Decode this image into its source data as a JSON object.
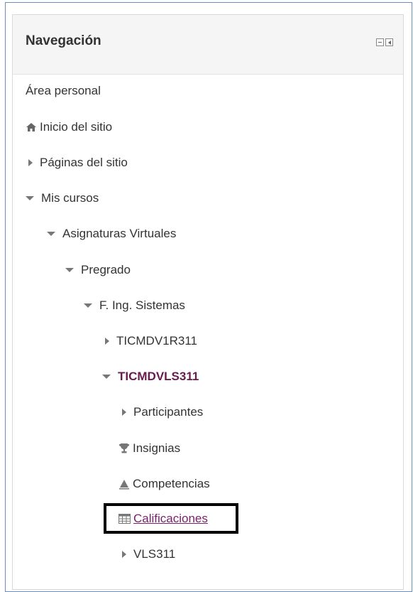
{
  "block": {
    "title": "Navegación",
    "controls": [
      "minimize-icon",
      "dock-icon"
    ]
  },
  "nav": [
    {
      "label": "Área personal",
      "icon": "none"
    },
    {
      "label": "Inicio del sitio",
      "icon": "home-icon"
    },
    {
      "label": "Páginas del sitio",
      "icon": "chevron-right-icon"
    },
    {
      "label": "Mis cursos",
      "icon": "chevron-down-icon"
    },
    {
      "label": "Asignaturas Virtuales",
      "icon": "chevron-down-icon"
    },
    {
      "label": "Pregrado",
      "icon": "chevron-down-icon"
    },
    {
      "label": "F. Ing. Sistemas",
      "icon": "chevron-down-icon"
    },
    {
      "label": "TICMDV1R311",
      "icon": "chevron-right-icon"
    },
    {
      "label": "TICMDVLS311",
      "icon": "chevron-down-icon",
      "state": "current"
    },
    {
      "label": "Participantes",
      "icon": "chevron-right-icon"
    },
    {
      "label": "Insignias",
      "icon": "trophy-icon"
    },
    {
      "label": "Competencias",
      "icon": "competency-icon"
    },
    {
      "label": "Calificaciones",
      "icon": "grades-table-icon",
      "state": "highlighted-link"
    },
    {
      "label": "VLS311",
      "icon": "chevron-right-icon"
    }
  ],
  "colors": {
    "frame_border": "#6c8ebf",
    "header_bg": "#f5f5f5",
    "text": "#333333",
    "current_course": "#6a1b4d",
    "link": "#7a1f6a",
    "highlight_border": "#000000"
  }
}
